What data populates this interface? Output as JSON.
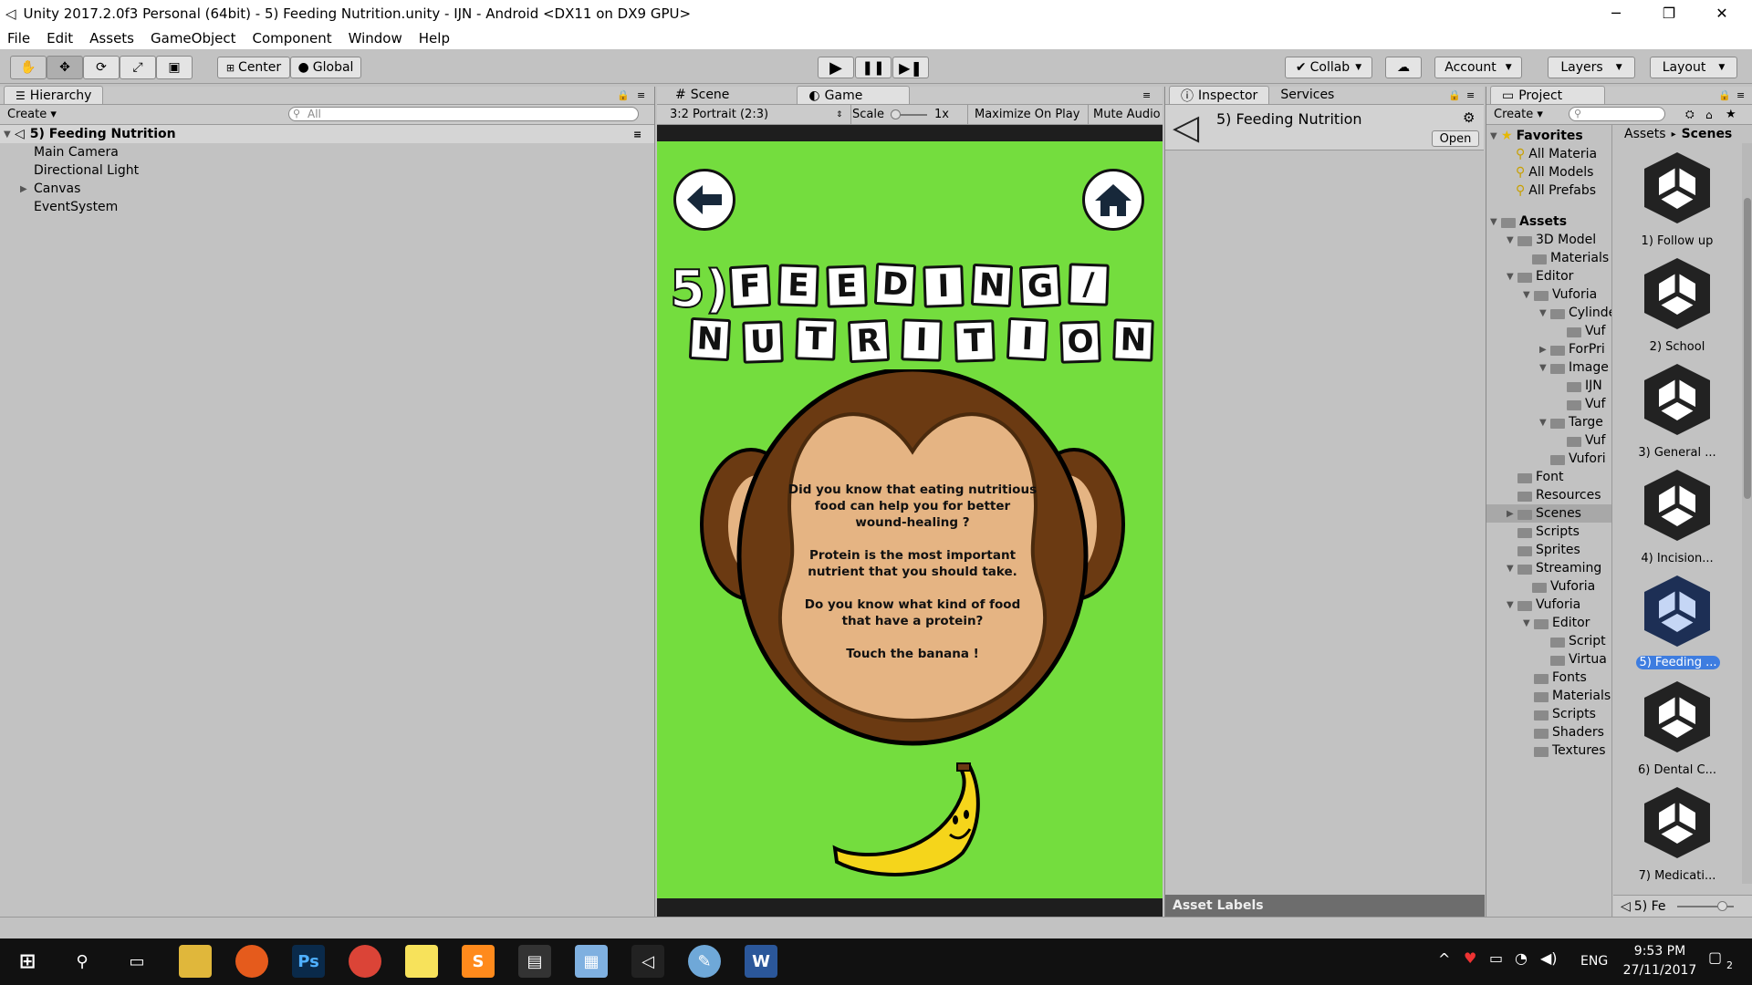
{
  "window": {
    "title": "Unity 2017.2.0f3 Personal (64bit) - 5) Feeding Nutrition.unity - IJN - Android <DX11 on DX9 GPU>",
    "minimize": "─",
    "restore": "❐",
    "close": "✕"
  },
  "menu": [
    "File",
    "Edit",
    "Assets",
    "GameObject",
    "Component",
    "Window",
    "Help"
  ],
  "toolbar": {
    "pivot": "Center",
    "space": "Global",
    "collab": "Collab",
    "account": "Account",
    "layers": "Layers",
    "layout": "Layout"
  },
  "hierarchy": {
    "tab": "Hierarchy",
    "create": "Create",
    "search_placeholder": "All",
    "scene_name": "5) Feeding Nutrition",
    "items": [
      "Main Camera",
      "Directional Light",
      "Canvas",
      "EventSystem"
    ]
  },
  "game": {
    "scene_tab": "Scene",
    "game_tab": "Game",
    "aspect": "3:2 Portrait (2:3)",
    "scale_label": "Scale",
    "scale_value": "1x",
    "maximize": "Maximize On Play",
    "mute": "Mute Audio",
    "title_line1": [
      "5)",
      "F",
      "E",
      "E",
      "D",
      "I",
      "N",
      "G",
      "/"
    ],
    "title_line2": [
      "N",
      "U",
      "T",
      "R",
      "I",
      "T",
      "I",
      "O",
      "N"
    ],
    "info": [
      "Did you know that eating nutritious",
      "food can help you for better",
      "wound-healing ?",
      "",
      "Protein is the most important",
      "nutrient that you should take.",
      "",
      "Do you know what kind of food",
      "that have a protein?",
      "",
      "Touch the banana !"
    ],
    "bg_color": "#74dd3e"
  },
  "inspector": {
    "tab": "Inspector",
    "services_tab": "Services",
    "object_name": "5) Feeding Nutrition",
    "open_button": "Open",
    "asset_labels": "Asset Labels"
  },
  "project": {
    "tab": "Project",
    "create": "Create",
    "breadcrumb_root": "Assets",
    "breadcrumb_sep": "▸",
    "breadcrumb_current": "Scenes",
    "favorites_label": "Favorites",
    "favorites": [
      "All Materia",
      "All Models",
      "All Prefabs"
    ],
    "assets_label": "Assets",
    "tree": [
      "3D Model",
      "Materials",
      "Editor",
      "Vuforia",
      "Cylinde",
      "Vuf",
      "ForPri",
      "Image",
      "IJN",
      "Vuf",
      "Targe",
      "Vuf",
      "Vufori",
      "Font",
      "Resources",
      "Scenes",
      "Scripts",
      "Sprites",
      "Streaming",
      "Vuforia",
      "Vuforia",
      "Editor",
      "Script",
      "Virtua",
      "Fonts",
      "Materials",
      "Scripts",
      "Shaders",
      "Textures"
    ],
    "scenes": [
      "1) Follow up",
      "2) School",
      "3) General ...",
      "4) Incision...",
      "5) Feeding ...",
      "6) Dental C...",
      "7) Medicati..."
    ],
    "footer_item": "5) Fe"
  },
  "taskbar": {
    "time": "9:53 PM",
    "date": "27/11/2017",
    "lang": "ENG",
    "notifications": "2"
  }
}
